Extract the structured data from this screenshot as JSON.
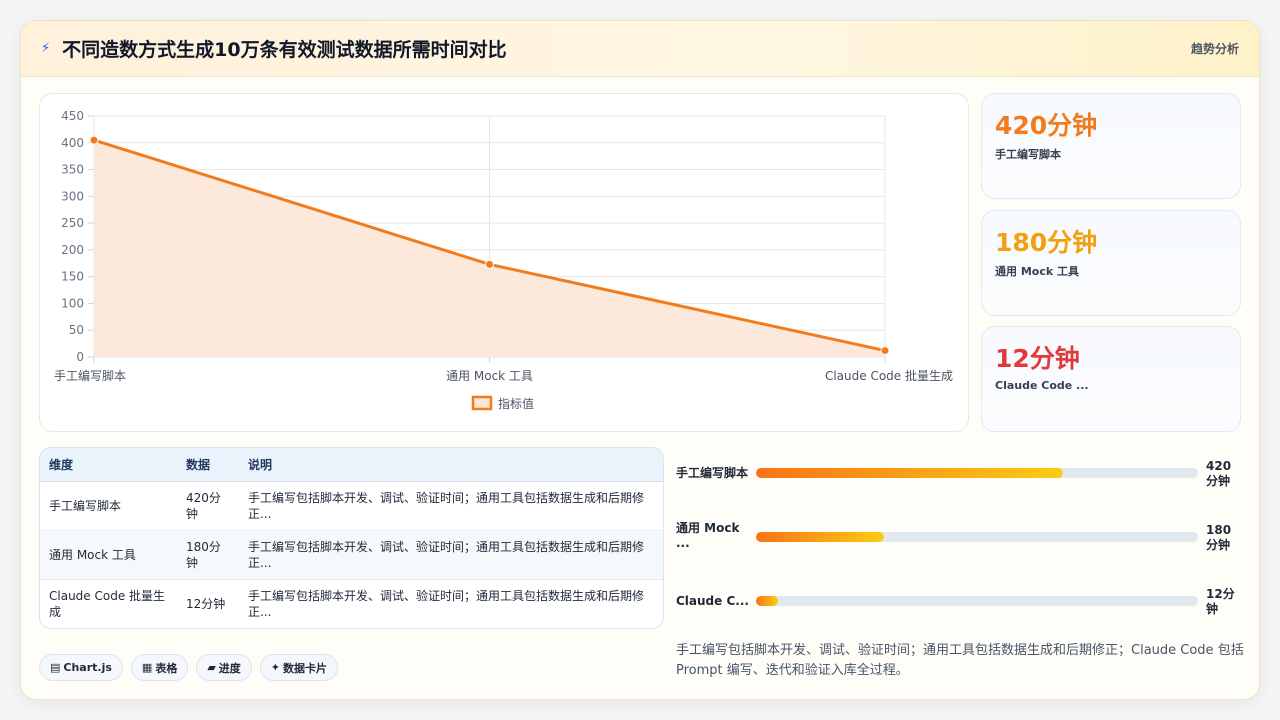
{
  "header": {
    "title": "不同造数方式生成10万条有效测试数据所需时间对比",
    "action_label": "趋势分析"
  },
  "chart_data": {
    "type": "area",
    "categories": [
      "手工编写脚本",
      "通用 Mock 工具",
      "Claude Code 批量生成"
    ],
    "series": [
      {
        "name": "指标值",
        "values": [
          405,
          173,
          12
        ]
      }
    ],
    "ylim": [
      0,
      450
    ],
    "yticks": [
      0,
      50,
      100,
      150,
      200,
      250,
      300,
      350,
      400,
      450
    ],
    "legend_position": "bottom",
    "grid": true,
    "colors": {
      "line": "#f07c1e",
      "area": "#fde7d8"
    }
  },
  "stats": [
    {
      "value": "420分钟",
      "label": "手工编写脚本",
      "color": "#f07c1e"
    },
    {
      "value": "180分钟",
      "label": "通用 Mock 工具",
      "color": "#f0a010"
    },
    {
      "value": "12分钟",
      "label": "Claude Code ...",
      "color": "#e03a3a"
    }
  ],
  "table": {
    "headers": [
      "维度",
      "数据",
      "说明"
    ],
    "rows": [
      {
        "dim": "手工编写脚本",
        "data": "420分钟",
        "desc": "手工编写包括脚本开发、调试、验证时间；通用工具包括数据生成和后期修正..."
      },
      {
        "dim": "通用 Mock 工具",
        "data": "180分钟",
        "desc": "手工编写包括脚本开发、调试、验证时间；通用工具包括数据生成和后期修正..."
      },
      {
        "dim": "Claude Code 批量生成",
        "data": "12分钟",
        "desc": "手工编写包括脚本开发、调试、验证时间；通用工具包括数据生成和后期修正..."
      }
    ]
  },
  "progress": [
    {
      "label": "手工编写脚本",
      "value": "420分钟",
      "fraction": 0.695
    },
    {
      "label": "通用 Mock ...",
      "value": "180分钟",
      "fraction": 0.29
    },
    {
      "label": "Claude C...",
      "value": "12分钟",
      "fraction": 0.05
    }
  ],
  "note": "手工编写包括脚本开发、调试、验证时间；通用工具包括数据生成和后期修正；Claude Code 包括 Prompt 编写、迭代和验证入库全过程。",
  "chips": [
    {
      "icon": "▤",
      "label": "Chart.js"
    },
    {
      "icon": "▦",
      "label": "表格"
    },
    {
      "icon": "▰",
      "label": "进度"
    },
    {
      "icon": "✦",
      "label": "数据卡片"
    }
  ]
}
